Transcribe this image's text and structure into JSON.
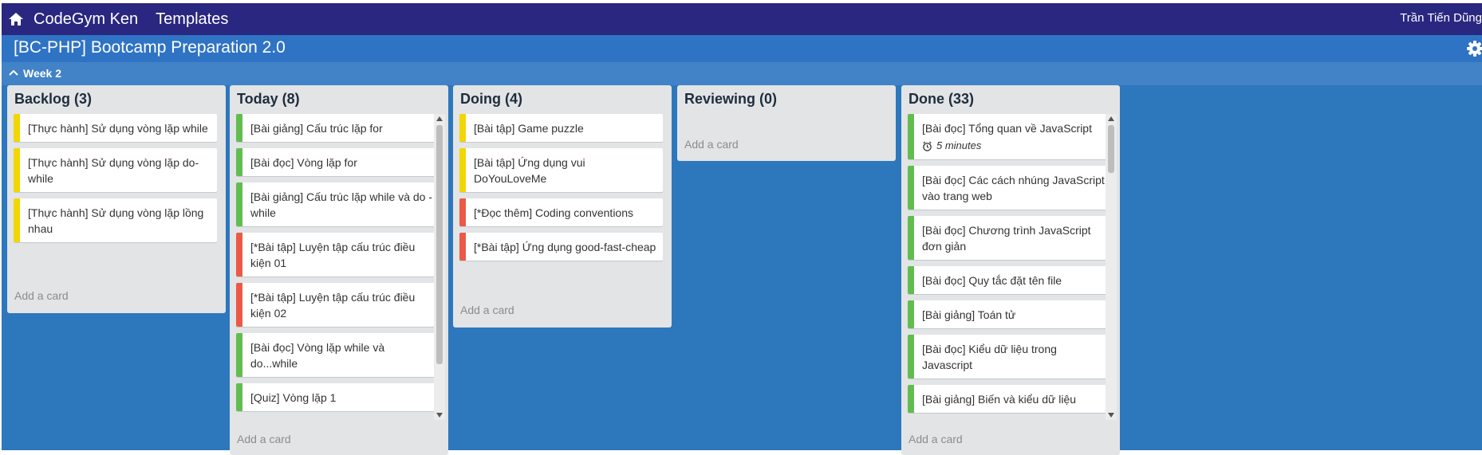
{
  "colors": {
    "navbar": "#2a2780",
    "boardbar": "#2f73c4",
    "canvas": "#2d77bd",
    "list_bg": "#e2e4e6",
    "label_yellow": "#f2d600",
    "label_green": "#61bd4f",
    "label_red": "#eb5a46"
  },
  "topnav": {
    "home_icon": "home-icon",
    "brand": "CodeGym Ken",
    "templates": "Templates",
    "user": "Trần Tiến Dũng"
  },
  "board": {
    "title": "[BC-PHP] Bootcamp Preparation 2.0",
    "settings_icon": "gear-icon"
  },
  "group": {
    "label": "Week 2",
    "toggle_icon": "chevron-up-icon"
  },
  "lists": [
    {
      "title": "Backlog (3)",
      "add_label": "Add a card",
      "cards": [
        {
          "text": "[Thực hành] Sử dụng vòng lặp while",
          "label": "yellow"
        },
        {
          "text": "[Thực hành] Sử dụng vòng lặp do-while",
          "label": "yellow"
        },
        {
          "text": "[Thực hành] Sử dụng vòng lặp lồng nhau",
          "label": "yellow"
        }
      ]
    },
    {
      "title": "Today (8)",
      "add_label": "Add a card",
      "cards": [
        {
          "text": "[Bài giảng] Cấu trúc lặp for",
          "label": "green"
        },
        {
          "text": "[Bài đọc] Vòng lặp for",
          "label": "green"
        },
        {
          "text": "[Bài giảng] Cấu trúc lặp while và do - while",
          "label": "green"
        },
        {
          "text": "[*Bài tập] Luyện tập cấu trúc điều kiện 01",
          "label": "red"
        },
        {
          "text": "[*Bài tập] Luyện tập cấu trúc điều kiện 02",
          "label": "red"
        },
        {
          "text": "[Bài đọc] Vòng lặp while và do...while",
          "label": "green"
        },
        {
          "text": "[Quiz] Vòng lặp 1",
          "label": "green"
        }
      ]
    },
    {
      "title": "Doing (4)",
      "add_label": "Add a card",
      "cards": [
        {
          "text": "[Bài tập] Game puzzle",
          "label": "yellow"
        },
        {
          "text": "[Bài tập] Ứng dụng vui DoYouLoveMe",
          "label": "yellow"
        },
        {
          "text": "[*Đọc thêm] Coding conventions",
          "label": "red"
        },
        {
          "text": "[*Bài tập] Ứng dụng good-fast-cheap",
          "label": "red"
        }
      ]
    },
    {
      "title": "Reviewing (0)",
      "add_label": "Add a card",
      "cards": []
    },
    {
      "title": "Done (33)",
      "add_label": "Add a card",
      "cards": [
        {
          "text": "[Bài đọc] Tổng quan về JavaScript",
          "label": "green",
          "meta": "5 minutes"
        },
        {
          "text": "[Bài đọc] Các cách nhúng JavaScript vào trang web",
          "label": "green"
        },
        {
          "text": "[Bài đọc] Chương trình JavaScript đơn giản",
          "label": "green"
        },
        {
          "text": "[Bài đọc] Quy tắc đặt tên file",
          "label": "green"
        },
        {
          "text": "[Bài giảng] Toán tử",
          "label": "green"
        },
        {
          "text": "[Bài đọc] Kiểu dữ liệu trong Javascript",
          "label": "green"
        },
        {
          "text": "[Bài giảng] Biến và kiểu dữ liệu",
          "label": "green"
        }
      ]
    }
  ]
}
